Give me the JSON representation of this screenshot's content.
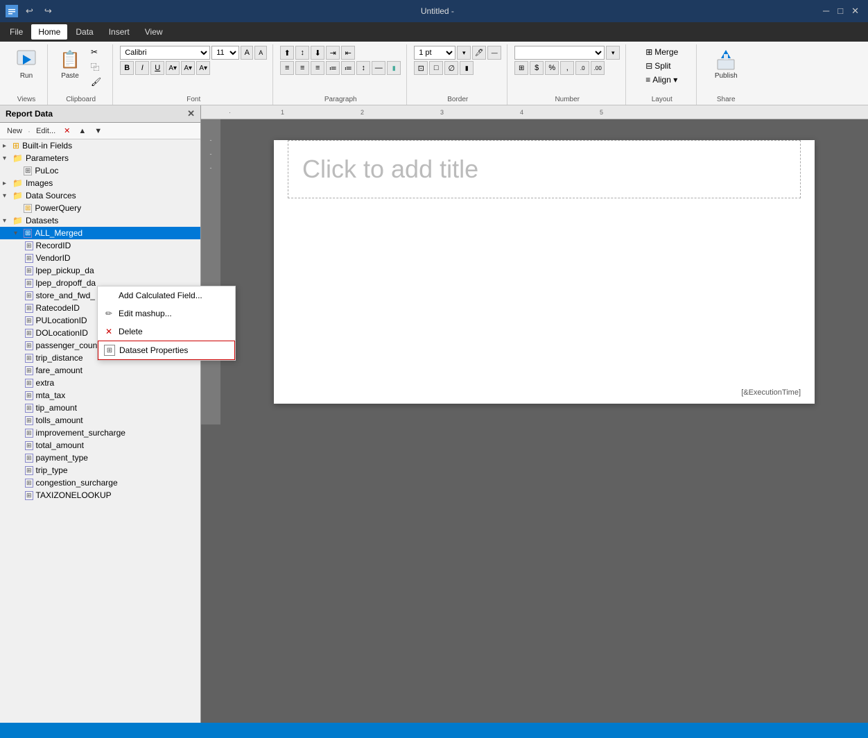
{
  "titleBar": {
    "title": "Untitled -",
    "undoBtn": "↩",
    "redoBtn": "↪"
  },
  "menuBar": {
    "items": [
      {
        "label": "File",
        "active": false
      },
      {
        "label": "Home",
        "active": true
      },
      {
        "label": "Data",
        "active": false
      },
      {
        "label": "Insert",
        "active": false
      },
      {
        "label": "View",
        "active": false
      }
    ]
  },
  "ribbon": {
    "groups": [
      {
        "label": "Views",
        "buttons": [
          {
            "icon": "▶",
            "label": "Run"
          }
        ]
      },
      {
        "label": "Clipboard",
        "buttons": [
          {
            "icon": "📋",
            "label": "Paste"
          }
        ]
      },
      {
        "label": "Font",
        "fontName": "Calibri",
        "fontSize": "11"
      },
      {
        "label": "Paragraph"
      },
      {
        "label": "Border",
        "borderSize": "1 pt"
      },
      {
        "label": "Number"
      },
      {
        "label": "Layout",
        "buttons": [
          {
            "icon": "⊞",
            "label": "Merge"
          },
          {
            "icon": "⊟",
            "label": "Split"
          },
          {
            "icon": "≡",
            "label": "Align"
          }
        ]
      },
      {
        "label": "Share",
        "buttons": [
          {
            "icon": "⬆",
            "label": "Publish"
          }
        ]
      }
    ]
  },
  "reportDataPanel": {
    "title": "Report Data",
    "toolbar": {
      "new": "New",
      "edit": "Edit...",
      "delete": "✕",
      "moveUp": "▲",
      "moveDown": "▼"
    },
    "tree": [
      {
        "level": 0,
        "type": "group",
        "label": "Built-in Fields",
        "expanded": true,
        "icon": "folder"
      },
      {
        "level": 0,
        "type": "group",
        "label": "Parameters",
        "expanded": true,
        "icon": "folder"
      },
      {
        "level": 1,
        "type": "param",
        "label": "PuLoc",
        "icon": "param"
      },
      {
        "level": 0,
        "type": "group",
        "label": "Images",
        "expanded": false,
        "icon": "folder"
      },
      {
        "level": 0,
        "type": "group",
        "label": "Data Sources",
        "expanded": true,
        "icon": "folder"
      },
      {
        "level": 1,
        "type": "datasource",
        "label": "PowerQuery",
        "icon": "datasource"
      },
      {
        "level": 0,
        "type": "group",
        "label": "Datasets",
        "expanded": true,
        "icon": "folder"
      },
      {
        "level": 1,
        "type": "dataset",
        "label": "ALL_Merged",
        "icon": "dataset",
        "selected": true
      },
      {
        "level": 2,
        "type": "field",
        "label": "RecordID",
        "icon": "field"
      },
      {
        "level": 2,
        "type": "field",
        "label": "VendorID",
        "icon": "field"
      },
      {
        "level": 2,
        "type": "field",
        "label": "lpep_pickup_da",
        "icon": "field"
      },
      {
        "level": 2,
        "type": "field",
        "label": "lpep_dropoff_da",
        "icon": "field"
      },
      {
        "level": 2,
        "type": "field",
        "label": "store_and_fwd_",
        "icon": "field"
      },
      {
        "level": 2,
        "type": "field",
        "label": "RatecodeID",
        "icon": "field"
      },
      {
        "level": 2,
        "type": "field",
        "label": "PULocationID",
        "icon": "field"
      },
      {
        "level": 2,
        "type": "field",
        "label": "DOLocationID",
        "icon": "field"
      },
      {
        "level": 2,
        "type": "field",
        "label": "passenger_count",
        "icon": "field"
      },
      {
        "level": 2,
        "type": "field",
        "label": "trip_distance",
        "icon": "field"
      },
      {
        "level": 2,
        "type": "field",
        "label": "fare_amount",
        "icon": "field"
      },
      {
        "level": 2,
        "type": "field",
        "label": "extra",
        "icon": "field"
      },
      {
        "level": 2,
        "type": "field",
        "label": "mta_tax",
        "icon": "field"
      },
      {
        "level": 2,
        "type": "field",
        "label": "tip_amount",
        "icon": "field"
      },
      {
        "level": 2,
        "type": "field",
        "label": "tolls_amount",
        "icon": "field"
      },
      {
        "level": 2,
        "type": "field",
        "label": "improvement_surcharge",
        "icon": "field"
      },
      {
        "level": 2,
        "type": "field",
        "label": "total_amount",
        "icon": "field"
      },
      {
        "level": 2,
        "type": "field",
        "label": "payment_type",
        "icon": "field"
      },
      {
        "level": 2,
        "type": "field",
        "label": "trip_type",
        "icon": "field"
      },
      {
        "level": 2,
        "type": "field",
        "label": "congestion_surcharge",
        "icon": "field"
      },
      {
        "level": 2,
        "type": "field",
        "label": "TAXIZONELOOKUP",
        "icon": "field"
      }
    ]
  },
  "canvas": {
    "titlePlaceholder": "Click to add title",
    "footer": "[&ExecutionTime]"
  },
  "contextMenu": {
    "items": [
      {
        "label": "Add Calculated Field...",
        "icon": "",
        "highlighted": false
      },
      {
        "label": "Edit mashup...",
        "icon": "✏",
        "highlighted": false
      },
      {
        "label": "Delete",
        "icon": "✕",
        "highlighted": false
      },
      {
        "label": "Dataset Properties",
        "icon": "⊞",
        "highlighted": true
      }
    ]
  },
  "statusBar": {}
}
